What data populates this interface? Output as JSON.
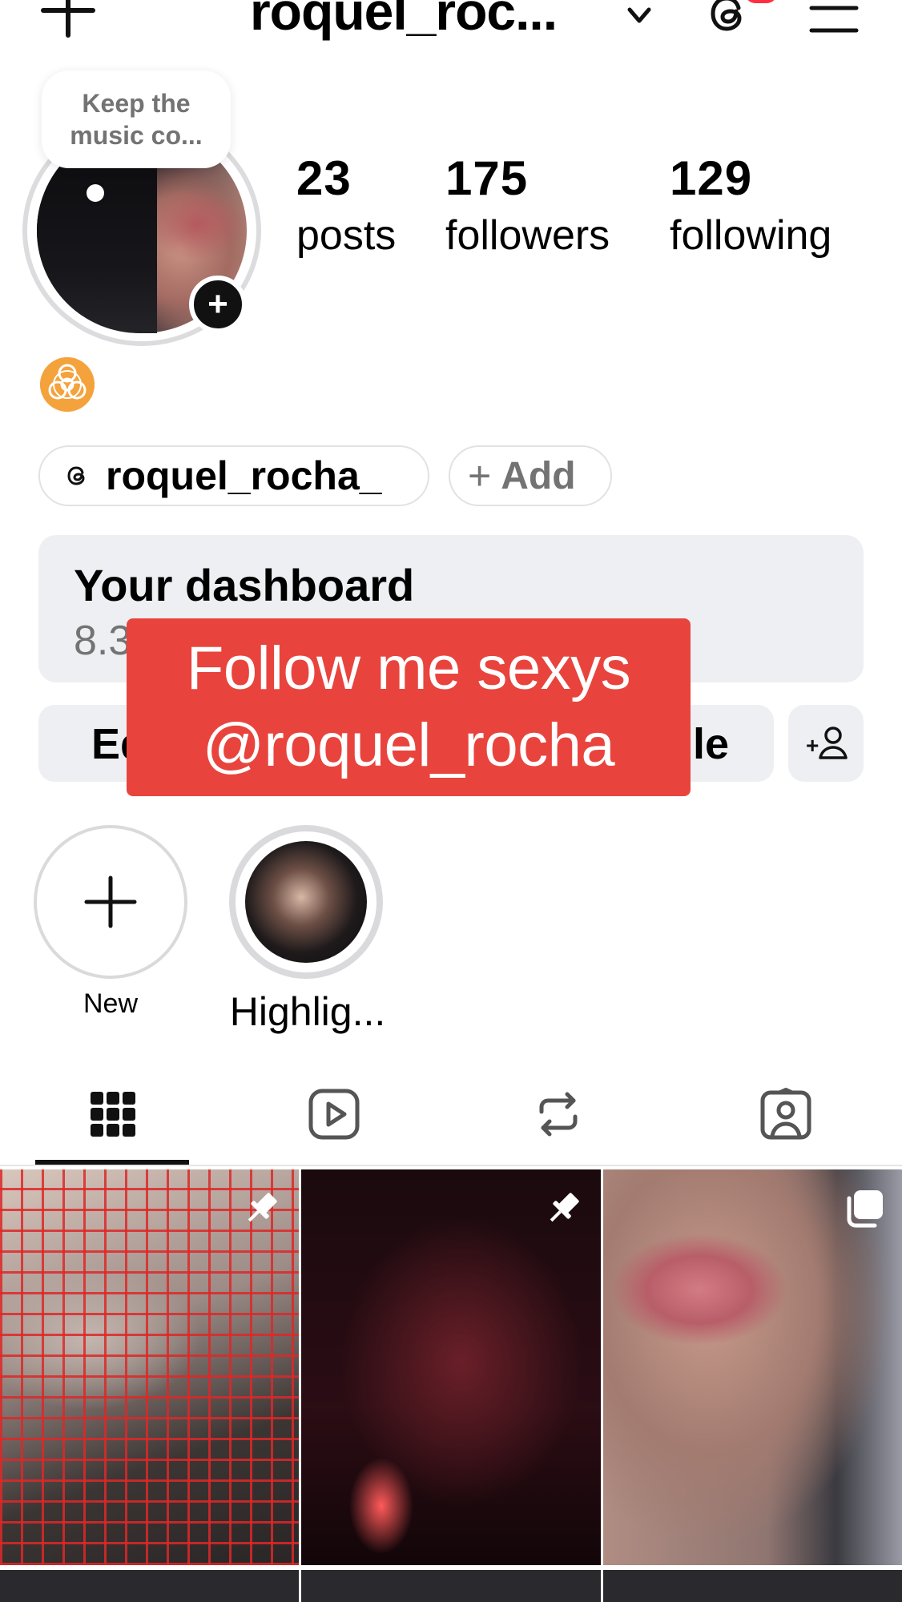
{
  "header": {
    "username": "roquel_roc...",
    "icons": [
      "plus-icon",
      "chevron-down-icon",
      "threads-icon",
      "menu-icon"
    ]
  },
  "profile": {
    "note": "Keep the music co...",
    "stats": {
      "posts": {
        "value": "23",
        "label": "posts"
      },
      "followers": {
        "value": "175",
        "label": "followers"
      },
      "following": {
        "value": "129",
        "label": "following"
      }
    },
    "emoji_icon": "biohazard-icon",
    "threads_handle": "roquel_rocha_",
    "add_label": "Add"
  },
  "dashboard": {
    "title": "Your dashboard",
    "subtitle_visible": "8.3"
  },
  "actions": {
    "edit_visible_start": "Ed",
    "edit_visible_end": "ile"
  },
  "overlay": {
    "line1": "Follow me sexys",
    "line2": "@roquel_rocha"
  },
  "highlights": [
    {
      "label": "New"
    },
    {
      "label": "Highlig..."
    }
  ],
  "tabs": [
    "grid-icon",
    "reels-icon",
    "repost-icon",
    "tagged-icon"
  ],
  "colors": {
    "overlay_red": "#e8443d",
    "badge_red": "#ff2f40",
    "muted_gray": "#737373",
    "button_bg": "#eeeff2"
  }
}
